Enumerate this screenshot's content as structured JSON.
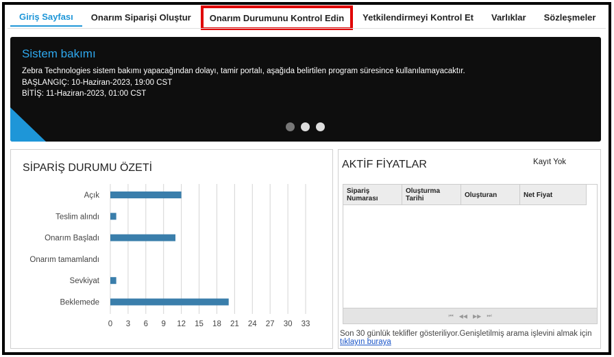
{
  "nav": {
    "items": [
      {
        "label": "Giriş Sayfası"
      },
      {
        "label": "Onarım Siparişi Oluştur"
      },
      {
        "label": "Onarım Durumunu Kontrol Edin"
      },
      {
        "label": "Yetkilendirmeyi Kontrol Et"
      },
      {
        "label": "Varlıklar"
      },
      {
        "label": "Sözleşmeler"
      }
    ]
  },
  "banner": {
    "title": "Sistem bakımı",
    "line1": "Zebra Technologies sistem bakımı yapacağından dolayı, tamir portalı, aşağıda belirtilen program süresince kullanılamayacaktır.",
    "line2": "BAŞLANGIÇ: 10-Haziran-2023, 19:00 CST",
    "line3": "BİTİŞ: 11-Haziran-2023, 01:00 CST"
  },
  "order_summary": {
    "title": "SİPARİŞ DURUMU ÖZETİ"
  },
  "chart_data": {
    "type": "bar",
    "orientation": "horizontal",
    "categories": [
      "Açık",
      "Teslim alındı",
      "Onarım Başladı",
      "Onarım tamamlandı",
      "Sevkiyat",
      "Beklemede"
    ],
    "values": [
      12,
      1,
      11,
      0,
      1,
      20
    ],
    "xticks": [
      "0",
      "3",
      "6",
      "9",
      "12",
      "15",
      "18",
      "21",
      "24",
      "27",
      "30",
      "33"
    ],
    "xlim": [
      0,
      33
    ],
    "grid": true,
    "bar_color": "#3a7eab"
  },
  "active_prices": {
    "title": "AKTİF FİYATLAR",
    "no_records": "Kayıt Yok",
    "columns": [
      "Sipariş Numarası",
      "Oluşturma Tarihi",
      "Oluşturan",
      "Net Fiyat"
    ],
    "pager": [
      "⏮",
      "◀◀",
      "▶▶",
      "⏭"
    ],
    "note_text": "Son 30 günlük teklifler gösteriliyor.Genişletilmiş arama işlevini almak için ",
    "note_link": "tıklayın buraya"
  }
}
